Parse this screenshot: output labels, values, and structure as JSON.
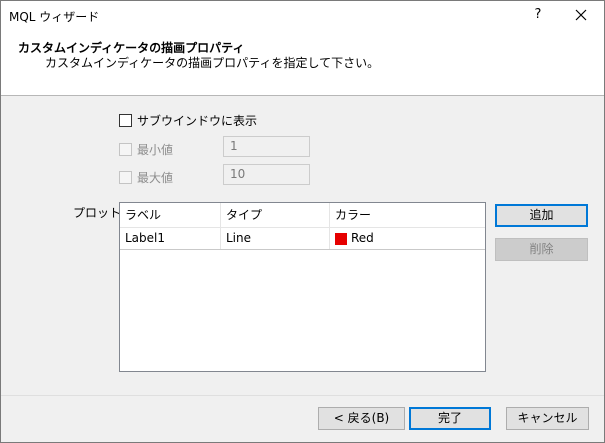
{
  "window": {
    "title": "MQL ウィザード",
    "help_symbol": "?",
    "close_symbol": "✕"
  },
  "header": {
    "title": "カスタムインディケータの描画プロパティ",
    "subtitle": "カスタムインディケータの描画プロパティを指定して下さい。"
  },
  "options": {
    "subwindow_label": "サブウインドウに表示",
    "subwindow_checked": false,
    "min_label": "最小値",
    "min_value": "1",
    "max_label": "最大値",
    "max_value": "10"
  },
  "plots": {
    "label": "プロット:",
    "columns": [
      "ラベル",
      "タイプ",
      "カラー"
    ],
    "rows": [
      {
        "label": "Label1",
        "type": "Line",
        "color_name": "Red",
        "color": "#e60000"
      }
    ]
  },
  "side_buttons": {
    "add": "追加",
    "delete": "削除"
  },
  "footer": {
    "back": "< 戻る(B)",
    "finish": "完了",
    "cancel": "キャンセル"
  }
}
